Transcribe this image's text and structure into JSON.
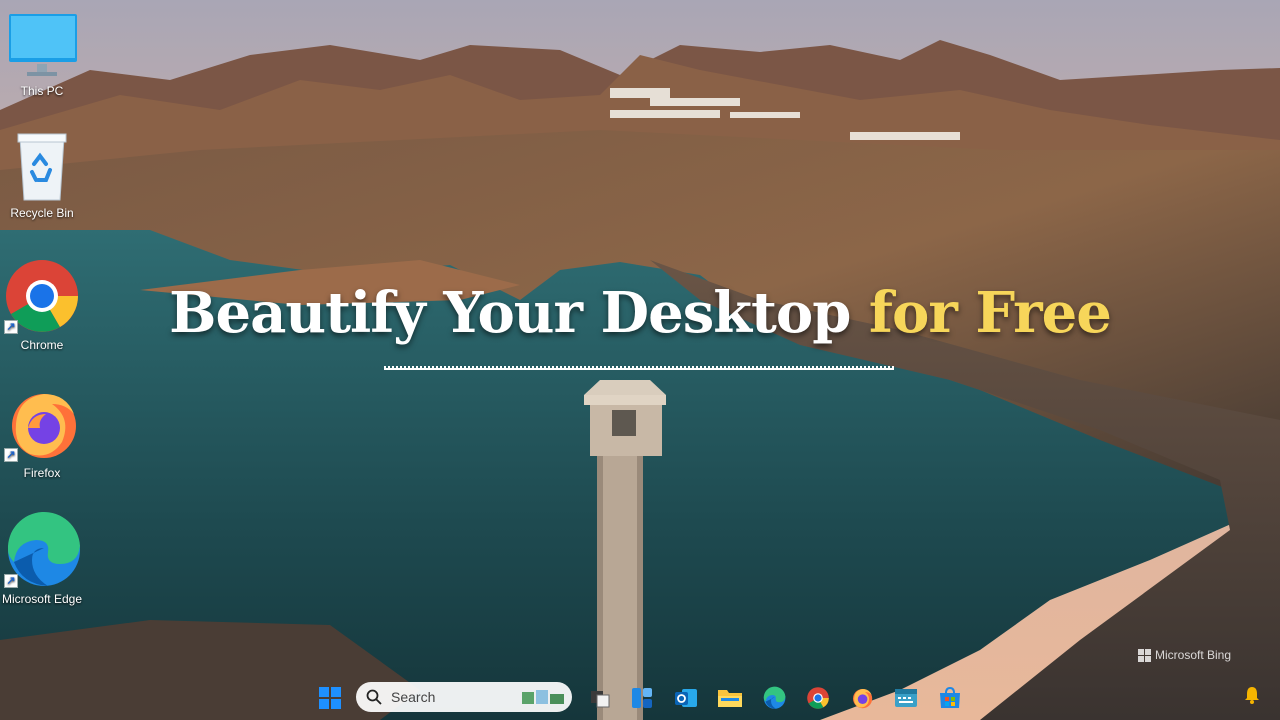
{
  "desktop": {
    "icons": [
      {
        "label": "This PC",
        "icon": "monitor-icon"
      },
      {
        "label": "Recycle Bin",
        "icon": "recycle-bin-icon"
      },
      {
        "label": "Chrome",
        "icon": "chrome-icon"
      },
      {
        "label": "Firefox",
        "icon": "firefox-icon"
      },
      {
        "label": "Microsoft Edge",
        "icon": "edge-icon"
      }
    ]
  },
  "headline": {
    "part1": "Beautify Your Desktop ",
    "part2": "for Free"
  },
  "watermark": {
    "label": "Microsoft Bing"
  },
  "taskbar": {
    "search_placeholder": "Search",
    "apps": [
      "start-icon",
      "task-view-icon",
      "widgets-icon",
      "outlook-icon",
      "file-explorer-icon",
      "edge-icon",
      "chrome-icon",
      "firefox-icon",
      "keyboard-app-icon",
      "store-icon"
    ]
  },
  "colors": {
    "headline_white": "#ffffff",
    "headline_accent": "#f7d65a",
    "water": "#1e4a50",
    "windows_blue": "#1e88e5"
  }
}
